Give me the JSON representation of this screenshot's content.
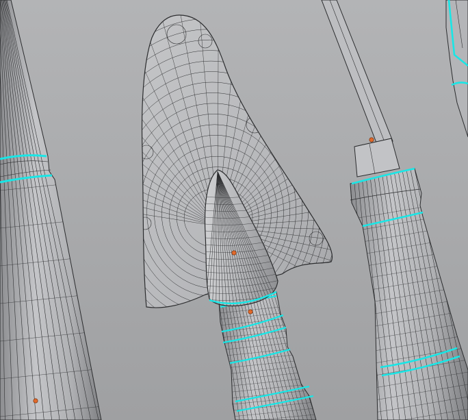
{
  "viewport": {
    "background_top": "#b3b4b6",
    "background_bottom": "#9fa0a2"
  },
  "colors": {
    "mesh_fill_light": "#c9cacc",
    "mesh_fill_mid": "#b9babd",
    "mesh_fill_dark": "#8f9093",
    "wire": "#2b2c2e",
    "seam_highlight": "#19e6e6",
    "origin_dot": "#e0692b"
  },
  "objects": [
    {
      "name": "left-handle-mesh",
      "selected_rings": 2
    },
    {
      "name": "trowel-blade-mesh",
      "selected_rings": 0
    },
    {
      "name": "trowel-handle-mesh",
      "selected_rings": 5
    },
    {
      "name": "right-handle-mesh",
      "selected_rings": 3
    },
    {
      "name": "far-right-edge-mesh",
      "selected_rings": 2
    }
  ]
}
